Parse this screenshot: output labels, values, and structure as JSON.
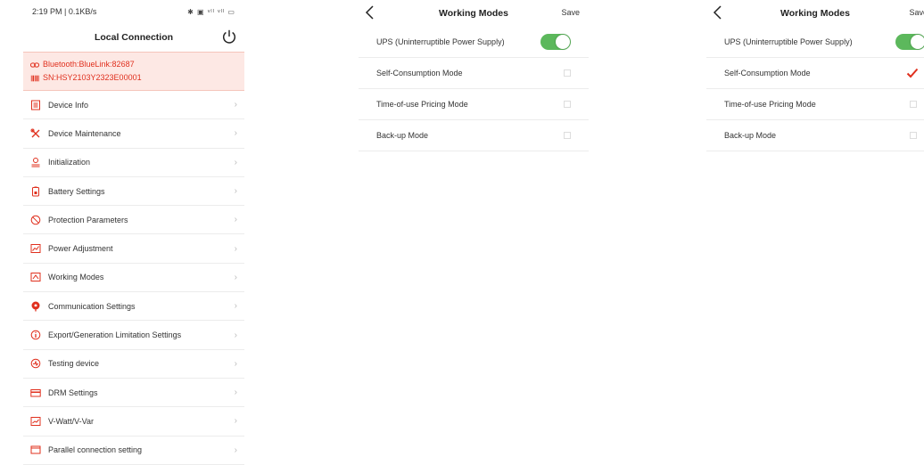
{
  "screen1": {
    "status": {
      "time": "2:19 PM | 0.1KB/s",
      "icons_text": "✱ ▣ ᵛˡˡ ᵛˡˡ ▭"
    },
    "title": "Local Connection",
    "connection": {
      "bluetooth": "Bluetooth:BlueLink:82687",
      "sn": "SN:HSY2103Y2323E00001"
    },
    "menu": [
      {
        "label": "Device Info",
        "icon": "document-icon"
      },
      {
        "label": "Device Maintenance",
        "icon": "tools-icon"
      },
      {
        "label": "Initialization",
        "icon": "person-icon"
      },
      {
        "label": "Battery Settings",
        "icon": "battery-icon"
      },
      {
        "label": "Protection Parameters",
        "icon": "shield-icon"
      },
      {
        "label": "Power Adjustment",
        "icon": "chart-icon"
      },
      {
        "label": "Working Modes",
        "icon": "modes-icon"
      },
      {
        "label": "Communication Settings",
        "icon": "antenna-icon"
      },
      {
        "label": "Export/Generation Limitation Settings",
        "icon": "info-icon"
      },
      {
        "label": "Testing device",
        "icon": "test-icon"
      },
      {
        "label": "DRM Settings",
        "icon": "card-icon"
      },
      {
        "label": "V-Watt/V-Var",
        "icon": "graph-icon"
      },
      {
        "label": "Parallel connection setting",
        "icon": "window-icon"
      }
    ]
  },
  "screen2": {
    "title": "Working Modes",
    "save": "Save",
    "rows": [
      {
        "label": "UPS (Uninterruptible Power Supply)",
        "control": "toggle",
        "on": true
      },
      {
        "label": "Self-Consumption Mode",
        "control": "checkbox",
        "checked": false
      },
      {
        "label": "Time-of-use Pricing Mode",
        "control": "checkbox",
        "checked": false
      },
      {
        "label": "Back-up Mode",
        "control": "checkbox",
        "checked": false
      }
    ]
  },
  "screen3": {
    "title": "Working Modes",
    "save": "Save",
    "rows": [
      {
        "label": "UPS (Uninterruptible Power Supply)",
        "control": "toggle",
        "on": true
      },
      {
        "label": "Self-Consumption Mode",
        "control": "checkbox",
        "checked": true
      },
      {
        "label": "Time-of-use Pricing Mode",
        "control": "checkbox",
        "checked": false
      },
      {
        "label": "Back-up Mode",
        "control": "checkbox",
        "checked": false
      }
    ]
  },
  "colors": {
    "accent_red": "#e0301e",
    "toggle_green": "#5cb85c",
    "connection_bg": "#fde8e4"
  }
}
